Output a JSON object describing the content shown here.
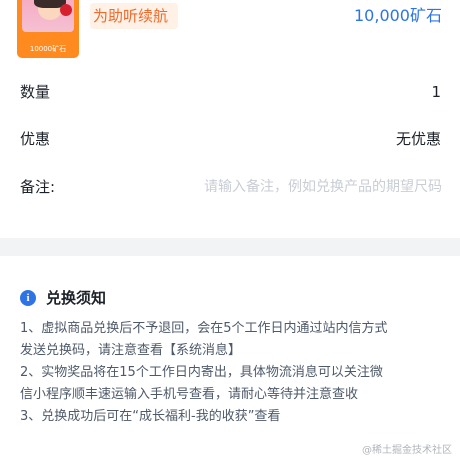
{
  "product": {
    "thumbnail_label": "10000矿石",
    "name": "为助听续航",
    "price": "10,000矿石"
  },
  "rows": [
    {
      "label": "数量",
      "value": "1"
    },
    {
      "label": "优惠",
      "value": "无优惠"
    },
    {
      "label": "备注:",
      "placeholder": "请输入备注，例如兑换产品的期望尺码"
    }
  ],
  "notice": {
    "icon": "info-icon",
    "title": "兑换须知",
    "lines": [
      "1、虚拟商品兑换后不予退回，会在5个工作日内通过站内信方式",
      "发送兑换码，请注意查看【系统消息】",
      "2、实物奖品将在15个工作日内寄出，具体物流消息可以关注微",
      "信小程序顺丰速运输入手机号查看，请耐心等待并注意查收",
      "3、兑换成功后可在“成长福利-我的收获”查看"
    ]
  },
  "watermark": "@稀土掘金技术社区",
  "colors": {
    "accent": "#2e74e6",
    "product_name": "#ef6a2c",
    "product_name_bg": "#fff1e6",
    "thumbnail_bg": "#ff8a1f",
    "separator": "#f2f3f5",
    "placeholder": "#c9cdd4"
  }
}
